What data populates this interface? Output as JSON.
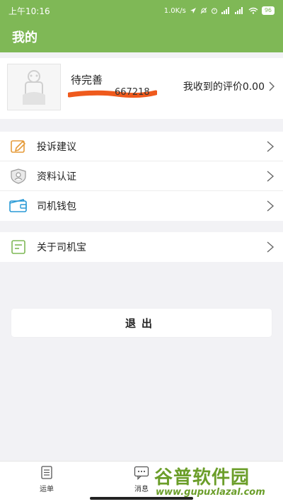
{
  "status_bar": {
    "time": "上午10:16",
    "speed": "1.0K/s",
    "battery": "96"
  },
  "header": {
    "title": "我的"
  },
  "profile": {
    "name": "待完善",
    "phone_partial": "667218",
    "rating_label": "我收到的评价0.00"
  },
  "menu_group1": [
    {
      "label": "投诉建议",
      "icon": "edit-icon"
    },
    {
      "label": "资料认证",
      "icon": "id-shield-icon"
    },
    {
      "label": "司机钱包",
      "icon": "wallet-icon"
    }
  ],
  "menu_group2": [
    {
      "label": "关于司机宝",
      "icon": "document-icon"
    }
  ],
  "logout_label": "退出",
  "tabs": [
    {
      "label": "运单",
      "icon": "waybill-icon"
    },
    {
      "label": "消息",
      "icon": "message-icon"
    }
  ],
  "watermark": {
    "title": "谷普软件园",
    "url": "www.gupuxlazal.com"
  },
  "colors": {
    "brand_green": "#7fb856",
    "redaction_orange": "#ef5a1d",
    "watermark_green": "#6b9e2a"
  }
}
